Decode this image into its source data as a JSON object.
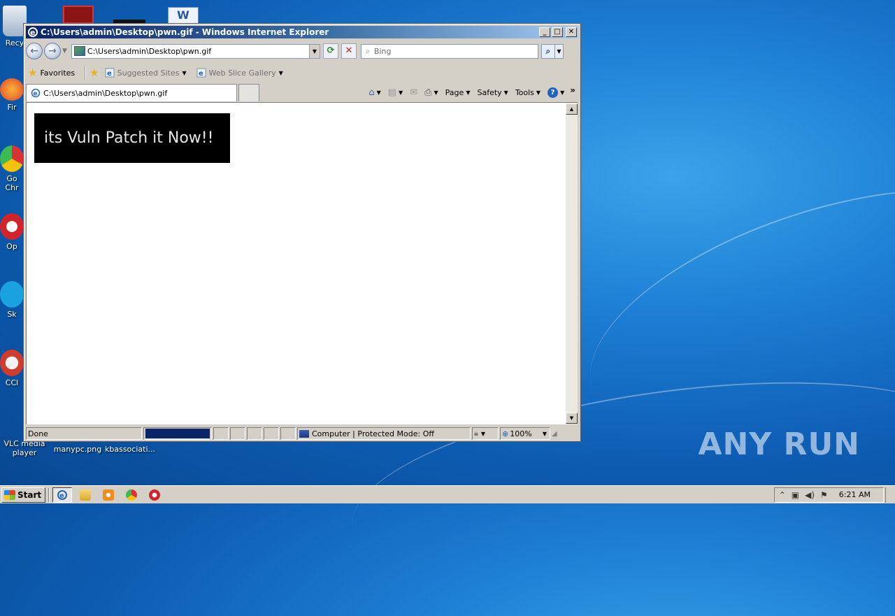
{
  "desktop": {
    "icons": [
      {
        "name": "recycle-bin",
        "label": "Recy",
        "color": "#b7c7d8"
      },
      {
        "name": "firefox",
        "label": "Fir",
        "color": "#e5652e"
      },
      {
        "name": "google-chrome",
        "label": "Go\nChr",
        "color": "#2e9c4a"
      },
      {
        "name": "opera",
        "label": "Op",
        "color": "#d2232a"
      },
      {
        "name": "skype",
        "label": "Sk",
        "color": "#1aa1e0"
      },
      {
        "name": "ccleaner",
        "label": "CCl",
        "color": "#d13b2b"
      },
      {
        "name": "vlc",
        "label": "VLC media\nplayer",
        "color": "#f08c1c"
      },
      {
        "name": "manypc",
        "label": "manypc.png",
        "color": "#4c93d8"
      },
      {
        "name": "kbassociati",
        "label": "kbassociati...",
        "color": "#e4ecf5"
      }
    ],
    "watermark": "ANY RUN"
  },
  "window": {
    "title": "C:\\Users\\admin\\Desktop\\pwn.gif - Windows Internet Explorer",
    "controls": {
      "minimize": "_",
      "maximize": "□",
      "close": "✕"
    }
  },
  "nav": {
    "back": "←",
    "forward": "→",
    "address": "C:\\Users\\admin\\Desktop\\pwn.gif",
    "refresh": "⟳",
    "stop": "✕",
    "search_placeholder": "Bing"
  },
  "favorites": {
    "label": "Favorites",
    "links": [
      {
        "label": "Suggested Sites"
      },
      {
        "label": "Web Slice Gallery"
      }
    ]
  },
  "tab": {
    "label": "C:\\Users\\admin\\Desktop\\pwn.gif"
  },
  "commands": {
    "page": "Page",
    "safety": "Safety",
    "tools": "Tools",
    "overflow": "»"
  },
  "content": {
    "gif_text": "its Vuln Patch it Now!!"
  },
  "status": {
    "text": "Done",
    "progress": 1.0,
    "zone": "Computer | Protected Mode: Off",
    "zoom": "100%"
  },
  "taskbar": {
    "start": "Start",
    "clock": "6:21 AM"
  }
}
